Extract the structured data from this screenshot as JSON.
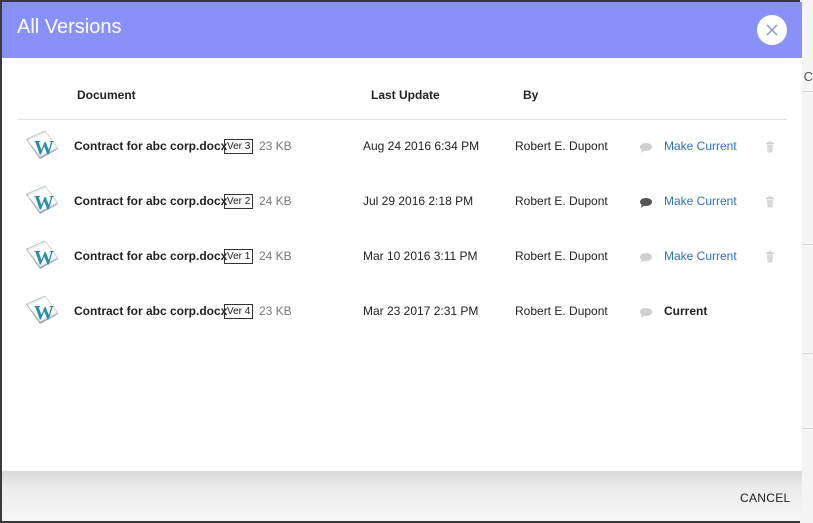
{
  "dialog": {
    "title": "All Versions",
    "close_icon": "close-icon",
    "colors": {
      "header": "#8891f7",
      "link": "#2f71c3"
    }
  },
  "columns": {
    "document": "Document",
    "last_update": "Last Update",
    "by": "By"
  },
  "background": {
    "edge_text": "C"
  },
  "rows": [
    {
      "name": "Contract for abc corp.docx",
      "version": "Ver 3",
      "size": "23 KB",
      "date": "Aug 24 2016 6:34 PM",
      "by": "Robert E. Dupont",
      "action": "Make Current",
      "comment_state": "light",
      "trash": true
    },
    {
      "name": "Contract for abc corp.docx",
      "version": "Ver 2",
      "size": "24 KB",
      "date": "Jul 29 2016 2:18 PM",
      "by": "Robert E. Dupont",
      "action": "Make Current",
      "comment_state": "dark",
      "trash": true
    },
    {
      "name": "Contract for abc corp.docx",
      "version": "Ver 1",
      "size": "24 KB",
      "date": "Mar 10 2016 3:11 PM",
      "by": "Robert E. Dupont",
      "action": "Make Current",
      "comment_state": "light",
      "trash": true
    },
    {
      "name": "Contract for abc corp.docx",
      "version": "Ver 4",
      "size": "23 KB",
      "date": "Mar 23 2017 2:31 PM",
      "by": "Robert E. Dupont",
      "action": "Current",
      "comment_state": "light",
      "trash": false
    }
  ],
  "footer": {
    "cancel_label": "CANCEL"
  }
}
